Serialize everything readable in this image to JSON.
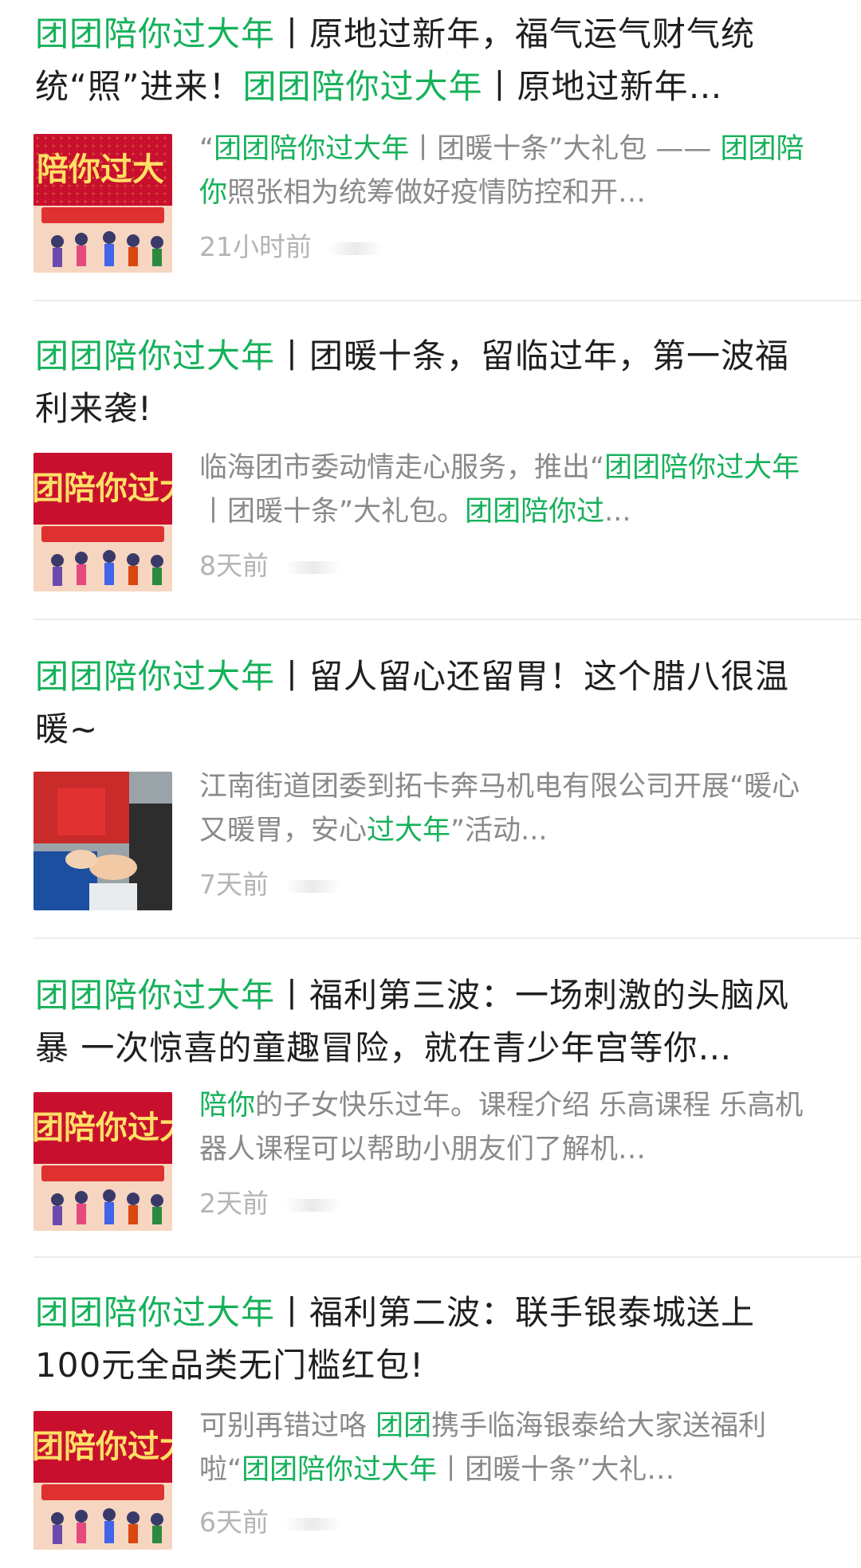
{
  "results": [
    {
      "title_parts": [
        {
          "text": "团团陪你过大年",
          "hl": true
        },
        {
          "text": "丨原地过新年，福气运气财气统统“照”进来！",
          "hl": false
        },
        {
          "text": "团团陪你过大年",
          "hl": true
        },
        {
          "text": "丨原地过新年…",
          "hl": false
        }
      ],
      "thumb": "festival-banner",
      "thumb_text": "陪你过大",
      "snippet_parts": [
        {
          "text": "“",
          "hl": false
        },
        {
          "text": "团团陪你过大年",
          "hl": true
        },
        {
          "text": "丨团暖十条”大礼包 —— ",
          "hl": false
        },
        {
          "text": "团团陪你",
          "hl": true
        },
        {
          "text": "照张相为统筹做好疫情防控和开…",
          "hl": false
        }
      ],
      "time": "21小时前"
    },
    {
      "title_parts": [
        {
          "text": "团团陪你过大年",
          "hl": true
        },
        {
          "text": "丨团暖十条，留临过年，第一波福利来袭!",
          "hl": false
        }
      ],
      "thumb": "festival-banner",
      "thumb_text": "团陪你过大",
      "snippet_parts": [
        {
          "text": "临海团市委动情走心服务，推出“",
          "hl": false
        },
        {
          "text": "团团陪你过大年",
          "hl": true
        },
        {
          "text": "丨团暖十条”大礼包。",
          "hl": false
        },
        {
          "text": "团团陪你过",
          "hl": true
        },
        {
          "text": "...",
          "hl": false
        }
      ],
      "time": "8天前"
    },
    {
      "title_parts": [
        {
          "text": "团团陪你过大年",
          "hl": true
        },
        {
          "text": "丨留人留心还留胃！这个腊八很温暖~",
          "hl": false
        }
      ],
      "thumb": "photo",
      "thumb_text": "",
      "snippet_parts": [
        {
          "text": "江南街道团委到拓卡奔马机电有限公司开展“暖心又暖胃，安心",
          "hl": false
        },
        {
          "text": "过大年",
          "hl": true
        },
        {
          "text": "”活动...",
          "hl": false
        }
      ],
      "time": "7天前"
    },
    {
      "title_parts": [
        {
          "text": "团团陪你过大年",
          "hl": true
        },
        {
          "text": "丨福利第三波：一场刺激的头脑风暴 一次惊喜的童趣冒险，就在青少年宫等你…",
          "hl": false
        }
      ],
      "thumb": "festival-banner",
      "thumb_text": "团陪你过大",
      "snippet_parts": [
        {
          "text": "陪你",
          "hl": true
        },
        {
          "text": "的子女快乐过年。课程介绍 乐高课程 乐高机器人课程可以帮助小朋友们了解机…",
          "hl": false
        }
      ],
      "time": "2天前"
    },
    {
      "title_parts": [
        {
          "text": "团团陪你过大年",
          "hl": true
        },
        {
          "text": "丨福利第二波：联手银泰城送上100元全品类无门槛红包!",
          "hl": false
        }
      ],
      "thumb": "festival-banner",
      "thumb_text": "团陪你过大",
      "snippet_parts": [
        {
          "text": "可别再错过咯 ",
          "hl": false
        },
        {
          "text": "团团",
          "hl": true
        },
        {
          "text": "携手临海银泰给大家送福利啦“",
          "hl": false
        },
        {
          "text": "团团陪你过大年",
          "hl": true
        },
        {
          "text": "丨团暖十条”大礼…",
          "hl": false
        }
      ],
      "time": "6天前"
    }
  ],
  "colors": {
    "highlight": "#15b15a",
    "title": "#1f1f1f",
    "snippet": "#8a8a8a",
    "meta": "#b4b4b4",
    "divider": "#ececec"
  }
}
